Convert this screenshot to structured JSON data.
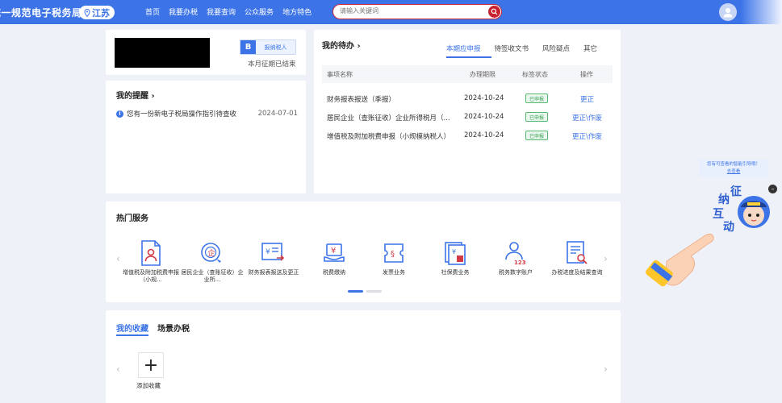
{
  "header": {
    "site_title": "统一规范电子税务局",
    "region": "江苏",
    "nav": [
      "首页",
      "我要办税",
      "我要查询",
      "公众服务",
      "地方特色"
    ],
    "search_placeholder": "请输入关键词"
  },
  "profile": {
    "taxpayer_badge": "B",
    "taxpayer_type": "报纳税人",
    "period_status": "本月征期已结束"
  },
  "reminders": {
    "title": "我的提醒",
    "items": [
      {
        "text": "您有一份新电子税局操作指引待查收",
        "date": "2024-07-01"
      }
    ]
  },
  "todo": {
    "title": "我的待办",
    "tabs": [
      "本期应申报",
      "待签收文书",
      "风险疑点",
      "其它"
    ],
    "columns": [
      "事项名称",
      "办理期限",
      "标签状态",
      "操作"
    ],
    "rows": [
      {
        "name": "财务报表报送（季报）",
        "deadline": "2024-10-24",
        "status": "已申报",
        "action": "更正"
      },
      {
        "name": "居民企业（查账征收）企业所得税月（...",
        "deadline": "2024-10-24",
        "status": "已申报",
        "action": "更正\\作废"
      },
      {
        "name": "增值税及附加税费申报（小规模纳税人）",
        "deadline": "2024-10-24",
        "status": "已申报",
        "action": "更正\\作废"
      }
    ]
  },
  "hot_services": {
    "title": "热门服务",
    "items": [
      {
        "label": "增值税及附加税费申报（小规...",
        "icon": "document-person-icon"
      },
      {
        "label": "居民企业（查账征收）企业所...",
        "icon": "enterprise-seal-icon"
      },
      {
        "label": "财务报表报送及更正",
        "icon": "report-send-icon"
      },
      {
        "label": "税费缴纳",
        "icon": "tax-payment-icon"
      },
      {
        "label": "发票业务",
        "icon": "invoice-icon"
      },
      {
        "label": "社保费业务",
        "icon": "social-security-icon"
      },
      {
        "label": "税务数字账户",
        "icon": "digital-account-icon"
      },
      {
        "label": "办税进度及结果查询",
        "icon": "progress-query-icon"
      }
    ]
  },
  "favorites": {
    "tabs": [
      "我的收藏",
      "场景办税"
    ],
    "add_label": "添加收藏"
  },
  "assistant": {
    "tip_line1": "您有可查看的智能引导哦！",
    "tip_line2": "去查看",
    "chars": [
      "征",
      "纳",
      "互",
      "动"
    ]
  },
  "colors": {
    "primary": "#3c74e8",
    "search_border": "#cc2a3a",
    "success": "#3ba256"
  }
}
